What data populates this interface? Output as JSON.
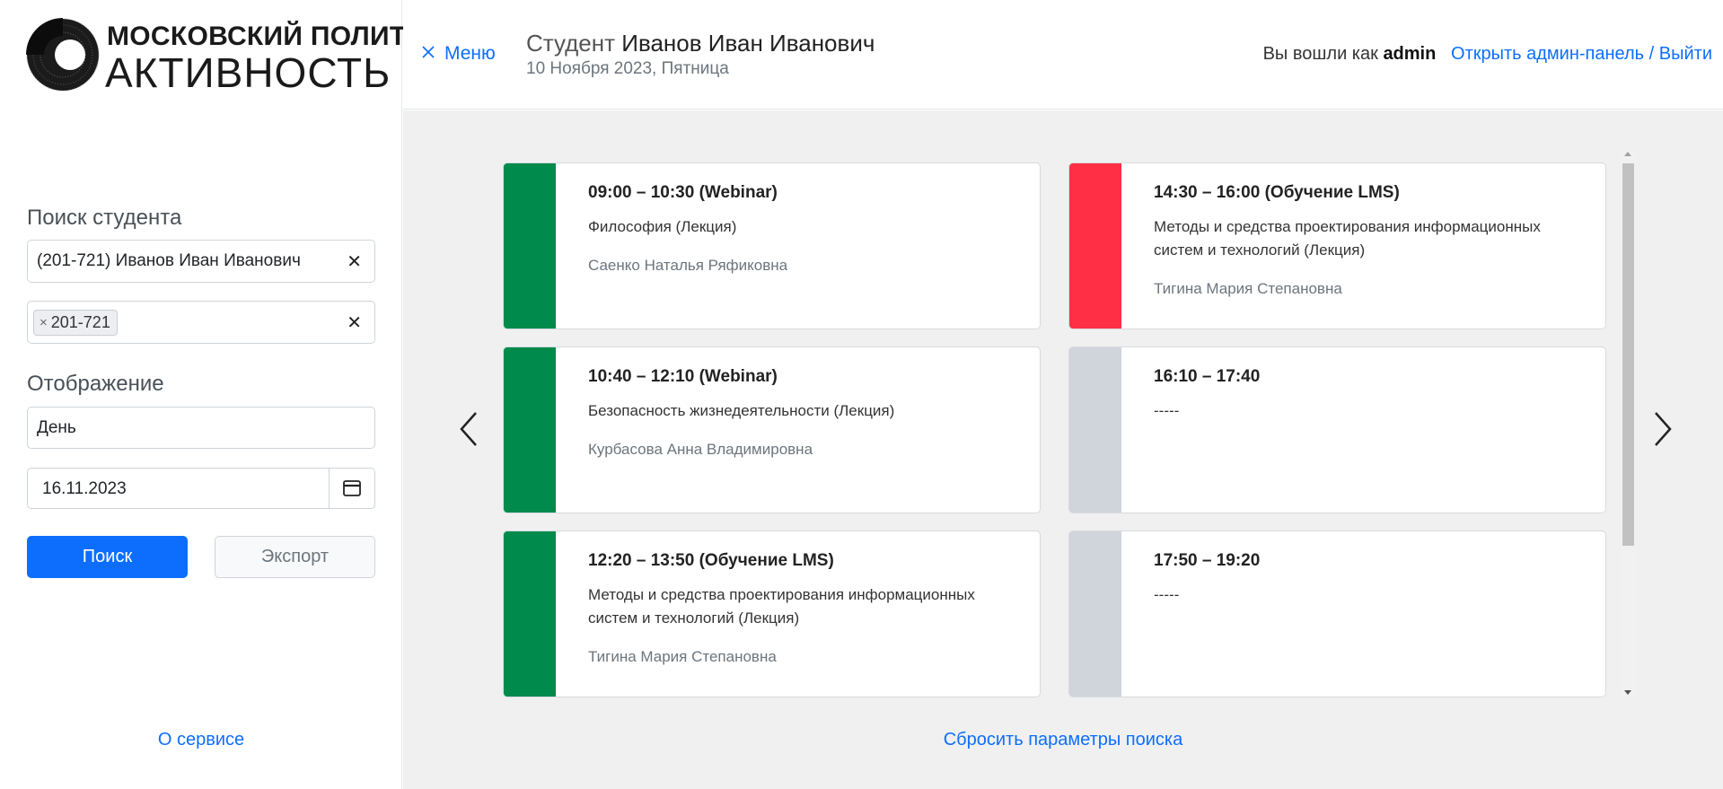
{
  "logo": {
    "top": "МОСКОВСКИЙ ПОЛИТЕХ",
    "bottom": "АКТИВНОСТЬ"
  },
  "sidebar": {
    "search_label": "Поиск студента",
    "student_value": "(201-721) Иванов Иван Иванович",
    "group_tag": "201-721",
    "display_label": "Отображение",
    "display_value": "День",
    "date_value": "16.11.2023",
    "search_button": "Поиск",
    "export_button": "Экспорт",
    "about_link": "О сервисе"
  },
  "header": {
    "menu_label": "Меню",
    "student_prefix": "Студент",
    "student_name": "Иванов Иван Иванович",
    "date": "10 Ноября 2023, Пятница",
    "logged_in_text": "Вы вошли как",
    "username": "admin",
    "admin_link": "Открыть админ-панель",
    "separator": "/",
    "logout_link": "Выйти"
  },
  "schedule": {
    "cards": [
      {
        "time": "09:00 – 10:30 (Webinar)",
        "subject": "Философия (Лекция)",
        "teacher": "Саенко Наталья Ряфиковна",
        "color": "#008a4c"
      },
      {
        "time": "10:40 – 12:10 (Webinar)",
        "subject": "Безопасность жизнедеятельности (Лекция)",
        "teacher": "Курбасова Анна Владимировна",
        "color": "#008a4c"
      },
      {
        "time": "12:20 – 13:50 (Обучение LMS)",
        "subject": "Методы и средства проектирования информационных систем и технологий (Лекция)",
        "teacher": "Тигина Мария Степановна",
        "color": "#008a4c"
      },
      {
        "time": "14:30 – 16:00 (Обучение LMS)",
        "subject": "Методы и средства проектирования информационных систем и технологий (Лекция)",
        "teacher": "Тигина Мария Степановна",
        "color": "#ff3045"
      },
      {
        "time": "16:10 – 17:40",
        "subject": "-----",
        "teacher": "",
        "color": "#d0d5db"
      },
      {
        "time": "17:50 – 19:20",
        "subject": "-----",
        "teacher": "",
        "color": "#d0d5db"
      }
    ],
    "reset_link": "Сбросить параметры поиска"
  },
  "colors": {
    "accent": "#0d6efd",
    "online": "#008a4c",
    "alert": "#ff3045",
    "empty": "#d0d5db"
  }
}
